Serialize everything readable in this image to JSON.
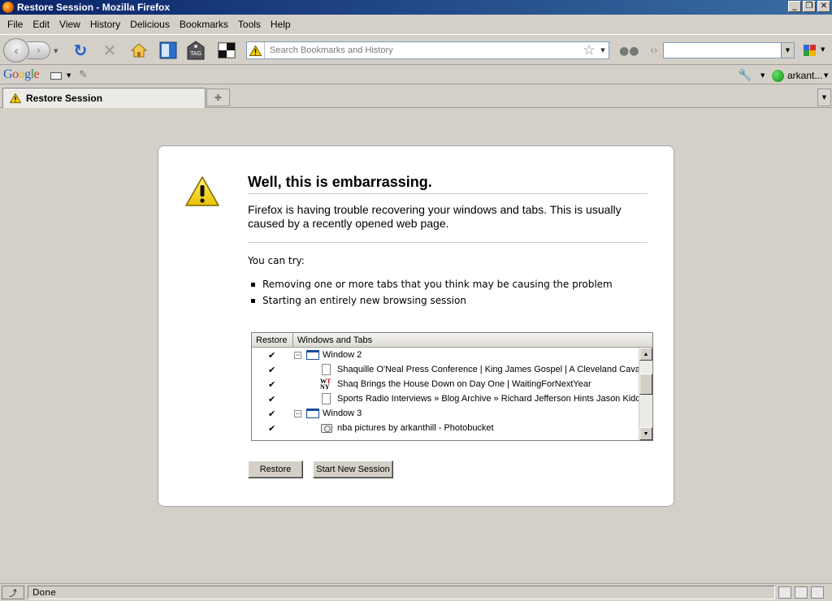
{
  "window": {
    "title": "Restore Session - Mozilla Firefox",
    "controls": {
      "minimize": "_",
      "restore": "❐",
      "close": "✕"
    }
  },
  "menu": [
    {
      "key": "file",
      "label": "File"
    },
    {
      "key": "edit",
      "label": "Edit"
    },
    {
      "key": "view",
      "label": "View"
    },
    {
      "key": "history",
      "label": "History"
    },
    {
      "key": "delicious",
      "label": "Delicious"
    },
    {
      "key": "bookmarks",
      "label": "Bookmarks"
    },
    {
      "key": "tools",
      "label": "Tools"
    },
    {
      "key": "help",
      "label": "Help"
    }
  ],
  "navbar": {
    "url_placeholder": "Search Bookmarks and History",
    "url_value": "",
    "search_value": "",
    "tag_icon_label": "TAG"
  },
  "google_bar": {
    "logo": [
      "G",
      "o",
      "o",
      "g",
      "l",
      "e"
    ],
    "user": "arkant..."
  },
  "tabs": [
    {
      "label": "Restore Session",
      "active": true
    }
  ],
  "page": {
    "title": "Well, this is embarrassing.",
    "message": "Firefox is having trouble recovering your windows and tabs. This is usually caused by a recently opened web page.",
    "try_label": "You can try:",
    "suggestions": [
      "Removing one or more tabs that you think may be causing the problem",
      "Starting an entirely new browsing session"
    ],
    "tree": {
      "columns": {
        "restore": "Restore",
        "windows": "Windows and Tabs"
      },
      "rows": [
        {
          "type": "window",
          "label": "Window 2",
          "checked": true,
          "expanded": true
        },
        {
          "type": "page",
          "label": "Shaquille O'Neal Press Conference | King James Gospel | A Cleveland Cavalier",
          "checked": true,
          "icon": "page-icon"
        },
        {
          "type": "page",
          "label": "Shaq Brings the House Down on Day One | WaitingForNextYear",
          "checked": true,
          "icon": "wtny-icon"
        },
        {
          "type": "page",
          "label": "Sports Radio Interviews » Blog Archive » Richard Jefferson Hints Jason Kidd I",
          "checked": true,
          "icon": "page-icon"
        },
        {
          "type": "window",
          "label": "Window 3",
          "checked": true,
          "expanded": true
        },
        {
          "type": "page",
          "label": "nba pictures by arkanthill - Photobucket",
          "checked": true,
          "icon": "camera-icon"
        }
      ]
    },
    "buttons": {
      "restore": "Restore",
      "new_session": "Start New Session"
    }
  },
  "status": {
    "text": "Done"
  }
}
